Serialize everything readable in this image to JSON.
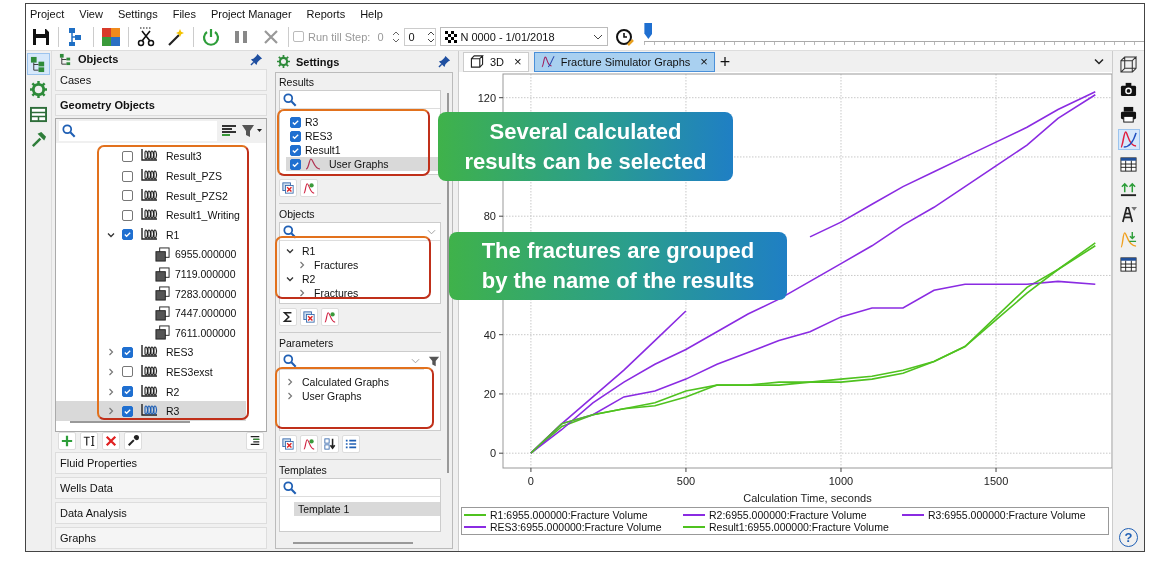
{
  "menu": [
    "Project",
    "View",
    "Settings",
    "Files",
    "Project Manager",
    "Reports",
    "Help"
  ],
  "toolbar": {
    "run_till_step": {
      "label": "Run till Step:",
      "checked": false,
      "disabled": true,
      "value": "0"
    },
    "step_value": "0",
    "step_select": "N 0000 - 1/01/2018",
    "timeline": {
      "level": 0
    }
  },
  "side_tabs": [
    {
      "kind": "tree",
      "selected": true
    },
    {
      "kind": "gear",
      "selected": false
    },
    {
      "kind": "layout",
      "selected": false
    },
    {
      "kind": "hammer",
      "selected": false
    }
  ],
  "objects_panel": {
    "title": "Objects",
    "sections_above": [
      {
        "label": "Cases",
        "selected": false
      },
      {
        "label": "Geometry Objects",
        "selected": true
      }
    ],
    "tree": [
      {
        "label": "Result3",
        "checked": false,
        "selected": false
      },
      {
        "label": "Result_PZS",
        "checked": false,
        "selected": false
      },
      {
        "label": "Result_PZS2",
        "checked": false,
        "selected": false
      },
      {
        "label": "Result1_Writing",
        "checked": false,
        "selected": false
      },
      {
        "label": "R1",
        "checked": true,
        "selected": false,
        "expanded": true,
        "children": [
          {
            "label": "6955.000000",
            "selected": false
          },
          {
            "label": "7119.000000",
            "selected": false
          },
          {
            "label": "7283.000000",
            "selected": false
          },
          {
            "label": "7447.000000",
            "selected": false
          },
          {
            "label": "7611.000000",
            "selected": false
          }
        ]
      },
      {
        "label": "RES3",
        "checked": true,
        "selected": false,
        "expanded": false
      },
      {
        "label": "RES3exst",
        "checked": false,
        "selected": false,
        "expanded": false
      },
      {
        "label": "R2",
        "checked": true,
        "selected": false,
        "expanded": false
      },
      {
        "label": "R3",
        "checked": true,
        "selected": true,
        "expanded": false
      }
    ],
    "sections_below": [
      {
        "label": "Fluid Properties",
        "selected": false
      },
      {
        "label": "Wells Data",
        "selected": false
      },
      {
        "label": "Data Analysis",
        "selected": false
      },
      {
        "label": "Graphs",
        "selected": false
      }
    ]
  },
  "settings_panel": {
    "title": "Settings",
    "results": {
      "title": "Results",
      "items": [
        {
          "label": "R3",
          "checked": true,
          "selected": false,
          "kind": "result"
        },
        {
          "label": "RES3",
          "checked": true,
          "selected": false,
          "kind": "result"
        },
        {
          "label": "Result1",
          "checked": true,
          "selected": false,
          "kind": "result"
        },
        {
          "label": "User Graphs",
          "checked": true,
          "selected": true,
          "kind": "graph"
        }
      ]
    },
    "objects": {
      "title": "Objects",
      "tree": [
        {
          "label": "R1",
          "expanded": true,
          "children": [
            {
              "label": "Fractures",
              "expanded": false
            }
          ]
        },
        {
          "label": "R2",
          "expanded": true,
          "children": [
            {
              "label": "Fractures",
              "expanded": false
            }
          ]
        }
      ]
    },
    "parameters": {
      "title": "Parameters",
      "tree": [
        {
          "label": "Calculated Graphs",
          "expanded": false
        },
        {
          "label": "User Graphs",
          "expanded": false
        }
      ]
    },
    "templates": {
      "title": "Templates",
      "items": [
        {
          "label": "Template 1",
          "selected": true
        }
      ]
    }
  },
  "tabs": [
    {
      "label": "3D",
      "kind": "cube",
      "selected": false,
      "close": "×"
    },
    {
      "label": "Fracture Simulator Graphs",
      "kind": "graph",
      "selected": true,
      "close": "×"
    }
  ],
  "add_tab": "+",
  "chart": {
    "chart_data": {
      "type": "line",
      "xlabel": "Calculation Time, seconds",
      "grid": true,
      "legend": true,
      "x": [
        0,
        100,
        200,
        300,
        400,
        500,
        600,
        700,
        800,
        900,
        1000,
        1100,
        1200,
        1300,
        1400,
        1500,
        1600,
        1700,
        1820
      ],
      "xlim": [
        -90,
        1874
      ],
      "ylim": [
        -5,
        128
      ],
      "xticks": [
        {
          "value": 0,
          "label": "0"
        },
        500,
        1000,
        1500
      ],
      "yticks": [
        {
          "value": 0,
          "label": "0"
        },
        20,
        40,
        80,
        120
      ],
      "series": [
        {
          "name": "R1:6955.000000:Fracture Volume",
          "color": "#4fc21f",
          "values": [
            0,
            9,
            13,
            15,
            17,
            21,
            23,
            23,
            23,
            24,
            25,
            26,
            28,
            31,
            36,
            46,
            56,
            62,
            71
          ]
        },
        {
          "name": "R2:6955.000000:Fracture Volume",
          "color": "#8a2be2",
          "values": [
            0,
            10,
            19,
            28,
            38,
            48,
            null,
            null,
            null,
            73,
            78,
            84,
            90,
            95,
            100,
            105,
            110,
            116,
            122
          ]
        },
        {
          "name": "R3:6955.000000:Fracture Volume",
          "color": "#8a2be2",
          "values": [
            0,
            10,
            13,
            19,
            21,
            25,
            30,
            34,
            38,
            41,
            46,
            49,
            49,
            55,
            57,
            57,
            57,
            58,
            57
          ]
        },
        {
          "name": "RES3:6955.000000:Fracture Volume",
          "color": "#8a2be2",
          "values": [
            0,
            8,
            17,
            24,
            30,
            35,
            41,
            47,
            52,
            58,
            64,
            70,
            77,
            83,
            90,
            97,
            104,
            113,
            121
          ]
        },
        {
          "name": "Result1:6955.000000:Fracture Volume",
          "color": "#4fc21f",
          "values": [
            0,
            10,
            13,
            15,
            16,
            19,
            23,
            23,
            24,
            24,
            24,
            25,
            27,
            31,
            36,
            45,
            54,
            62,
            70
          ]
        }
      ]
    }
  },
  "right_tools": [
    {
      "kind": "cube",
      "selected": false
    },
    {
      "kind": "camera",
      "selected": false
    },
    {
      "kind": "printer",
      "selected": false
    },
    {
      "kind": "graph",
      "selected": true
    },
    {
      "kind": "table",
      "selected": false
    },
    {
      "kind": "arrows",
      "selected": false
    },
    {
      "kind": "well",
      "selected": false
    },
    {
      "kind": "graph-down",
      "selected": false
    },
    {
      "kind": "table",
      "selected": false
    }
  ],
  "help": "?",
  "callouts": [
    {
      "lines": [
        "Several calculated",
        "results can be selected"
      ]
    },
    {
      "lines": [
        "The fractures are grouped",
        "by the name of the results"
      ]
    }
  ]
}
